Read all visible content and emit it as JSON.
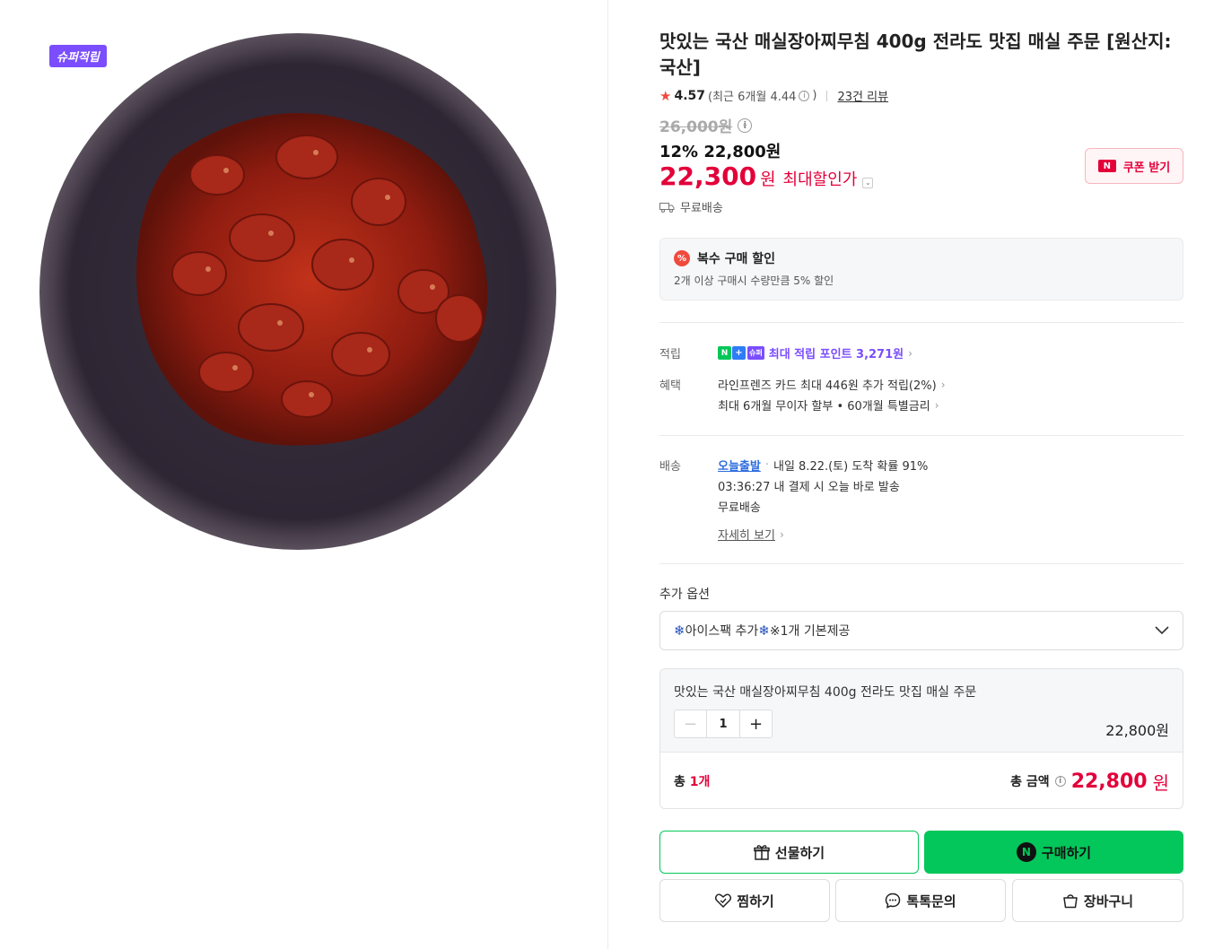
{
  "image": {
    "badge": "슈퍼적립",
    "alt": "매실장아찌무침"
  },
  "product": {
    "title": "맛있는 국산 매실장아찌무침 400g 전라도 맛집 매실 주문 [원산지: 국산]",
    "rating": "4.57",
    "recent_rating": "(최근 6개월 4.44",
    "recent_rating_close": ")",
    "review_count": "23건 리뷰",
    "original_price": "26,000원",
    "discount_line": "12% 22,800원",
    "max_price": "22,300",
    "max_unit": "원",
    "max_label": "최대할인가",
    "coupon_label": "쿠폰 받기",
    "shipping_tag": "무료배송"
  },
  "multi_discount": {
    "title": "복수 구매 할인",
    "desc": "2개 이상 구매시 수량만큼 5% 할인"
  },
  "benefits": {
    "points_label": "적립",
    "points_badge_super": "슈퍼",
    "points_text": "최대 적립 포인트 3,271원",
    "benefit_label": "혜택",
    "card_text": "라인프렌즈 카드 최대 446원 추가 적립(2%)",
    "installment_text": "최대 6개월 무이자 할부 • 60개월 특별금리"
  },
  "delivery": {
    "label": "배송",
    "today": "오늘출발",
    "arrival": "내일 8.22.(토) 도착 확률 91%",
    "cutoff": "03:36:27  내 결제 시 오늘 바로 발송",
    "fee": "무료배송",
    "detail_link": "자세히 보기"
  },
  "options": {
    "label": "추가 옵션",
    "selected": "아이스팩 추가",
    "selected_suffix": "※1개 기본제공"
  },
  "cart": {
    "item_name": "맛있는 국산 매실장아찌무침 400g 전라도 맛집 매실 주문",
    "quantity": "1",
    "item_price": "22,800원",
    "total_prefix": "총 ",
    "total_count": "1개",
    "total_label": "총 금액",
    "total_amount": "22,800",
    "total_unit": "원"
  },
  "buttons": {
    "gift": "선물하기",
    "buy": "구매하기",
    "zzim": "찜하기",
    "talk": "톡톡문의",
    "cart": "장바구니"
  },
  "colors": {
    "accent_red": "#e3003a",
    "naver_green": "#03c75a",
    "super_purple": "#7a4dff"
  }
}
